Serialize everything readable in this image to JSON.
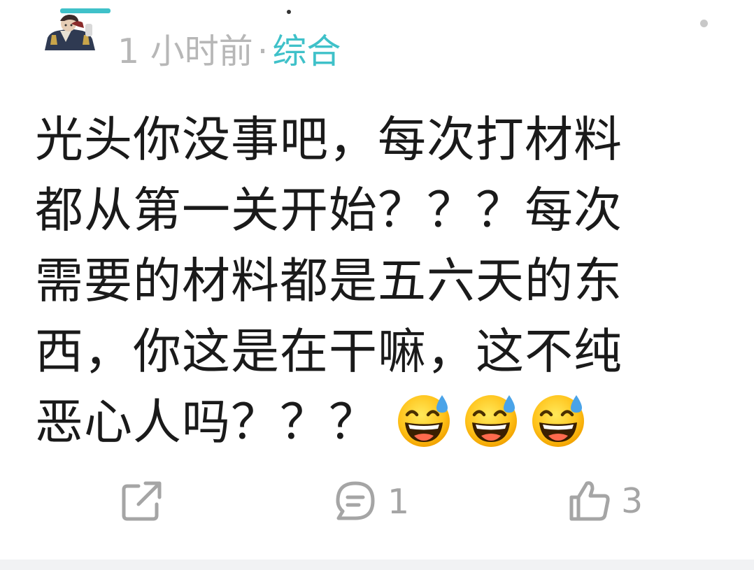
{
  "meta": {
    "time": "1 小时前",
    "separator": "·",
    "category": "综合"
  },
  "content": {
    "lines": [
      "光头你没事吧，每次打材料",
      "都从第一关开始？？？每次",
      "需要的材料都是五六天的东",
      "西，你这是在干嘛，这不纯",
      "恶心人吗？？？"
    ],
    "emojis": [
      "grinning-sweat-emoji",
      "grinning-sweat-emoji",
      "grinning-sweat-emoji"
    ]
  },
  "actions": {
    "share": {
      "icon": "share-icon"
    },
    "comment": {
      "icon": "comment-icon",
      "count": "1"
    },
    "like": {
      "icon": "thumbs-up-icon",
      "count": "3"
    }
  },
  "colors": {
    "accent": "#3fc1c9",
    "meta_text": "#b7b7b7",
    "body_text": "#1a1a1a",
    "action_icon": "#a5a5a5"
  }
}
